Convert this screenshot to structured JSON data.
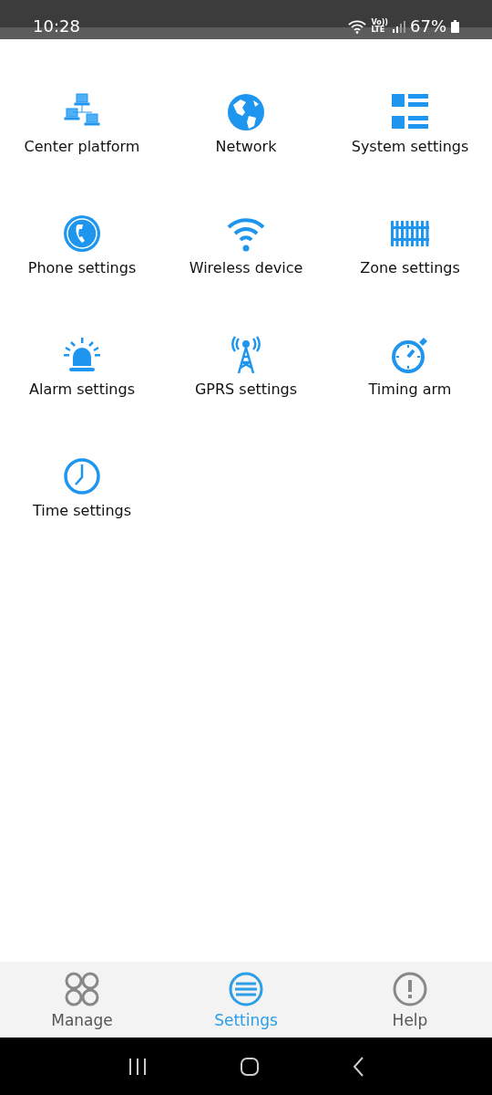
{
  "status_bar": {
    "time": "10:28",
    "volte_top": "Vo))",
    "volte_bottom": "LTE",
    "battery": "67%"
  },
  "menu": [
    {
      "label": "Center platform",
      "kind": "computers"
    },
    {
      "label": "Network",
      "kind": "globe"
    },
    {
      "label": "System settings",
      "kind": "layout"
    },
    {
      "label": "Phone settings",
      "kind": "phone"
    },
    {
      "label": "Wireless device",
      "kind": "wifi"
    },
    {
      "label": "Zone settings",
      "kind": "rail"
    },
    {
      "label": "Alarm settings",
      "kind": "siren"
    },
    {
      "label": "GPRS settings",
      "kind": "tower"
    },
    {
      "label": "Timing arm",
      "kind": "stopwatch"
    },
    {
      "label": "Time settings",
      "kind": "clock"
    }
  ],
  "tabs": [
    {
      "label": "Manage",
      "kind": "circles",
      "selected": false
    },
    {
      "label": "Settings",
      "kind": "lines",
      "selected": true
    },
    {
      "label": "Help",
      "kind": "alert",
      "selected": false
    }
  ]
}
